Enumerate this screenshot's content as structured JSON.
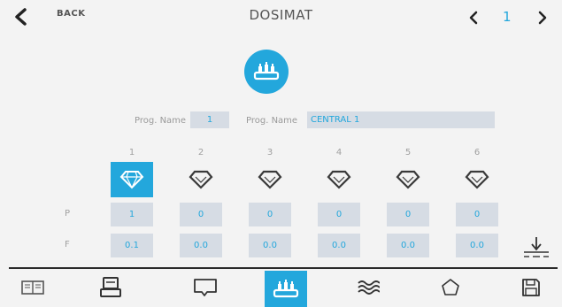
{
  "header": {
    "back_label": "BACK",
    "title": "DOSIMAT",
    "page_number": "1"
  },
  "program": {
    "label_1": "Prog. Name",
    "value_1": "1",
    "label_2": "Prog. Name",
    "value_2": "CENTRAL 1"
  },
  "columns": [
    {
      "number": "1",
      "p": "1",
      "f": "0.1",
      "selected": true
    },
    {
      "number": "2",
      "p": "0",
      "f": "0.0",
      "selected": false
    },
    {
      "number": "3",
      "p": "0",
      "f": "0.0",
      "selected": false
    },
    {
      "number": "4",
      "p": "0",
      "f": "0.0",
      "selected": false
    },
    {
      "number": "5",
      "p": "0",
      "f": "0.0",
      "selected": false
    },
    {
      "number": "6",
      "p": "0",
      "f": "0.0",
      "selected": false
    }
  ],
  "rows": {
    "p_label": "P",
    "f_label": "F"
  },
  "bottom_nav": {
    "items": [
      "book-icon",
      "scale-icon",
      "tray-icon",
      "dosing-icon",
      "waves-icon",
      "pentagon-icon",
      "save-icon"
    ],
    "selected": "dosing-icon"
  },
  "colors": {
    "accent": "#23a7dc",
    "field_bg": "#d6dce4",
    "background": "#f3f3f3"
  }
}
